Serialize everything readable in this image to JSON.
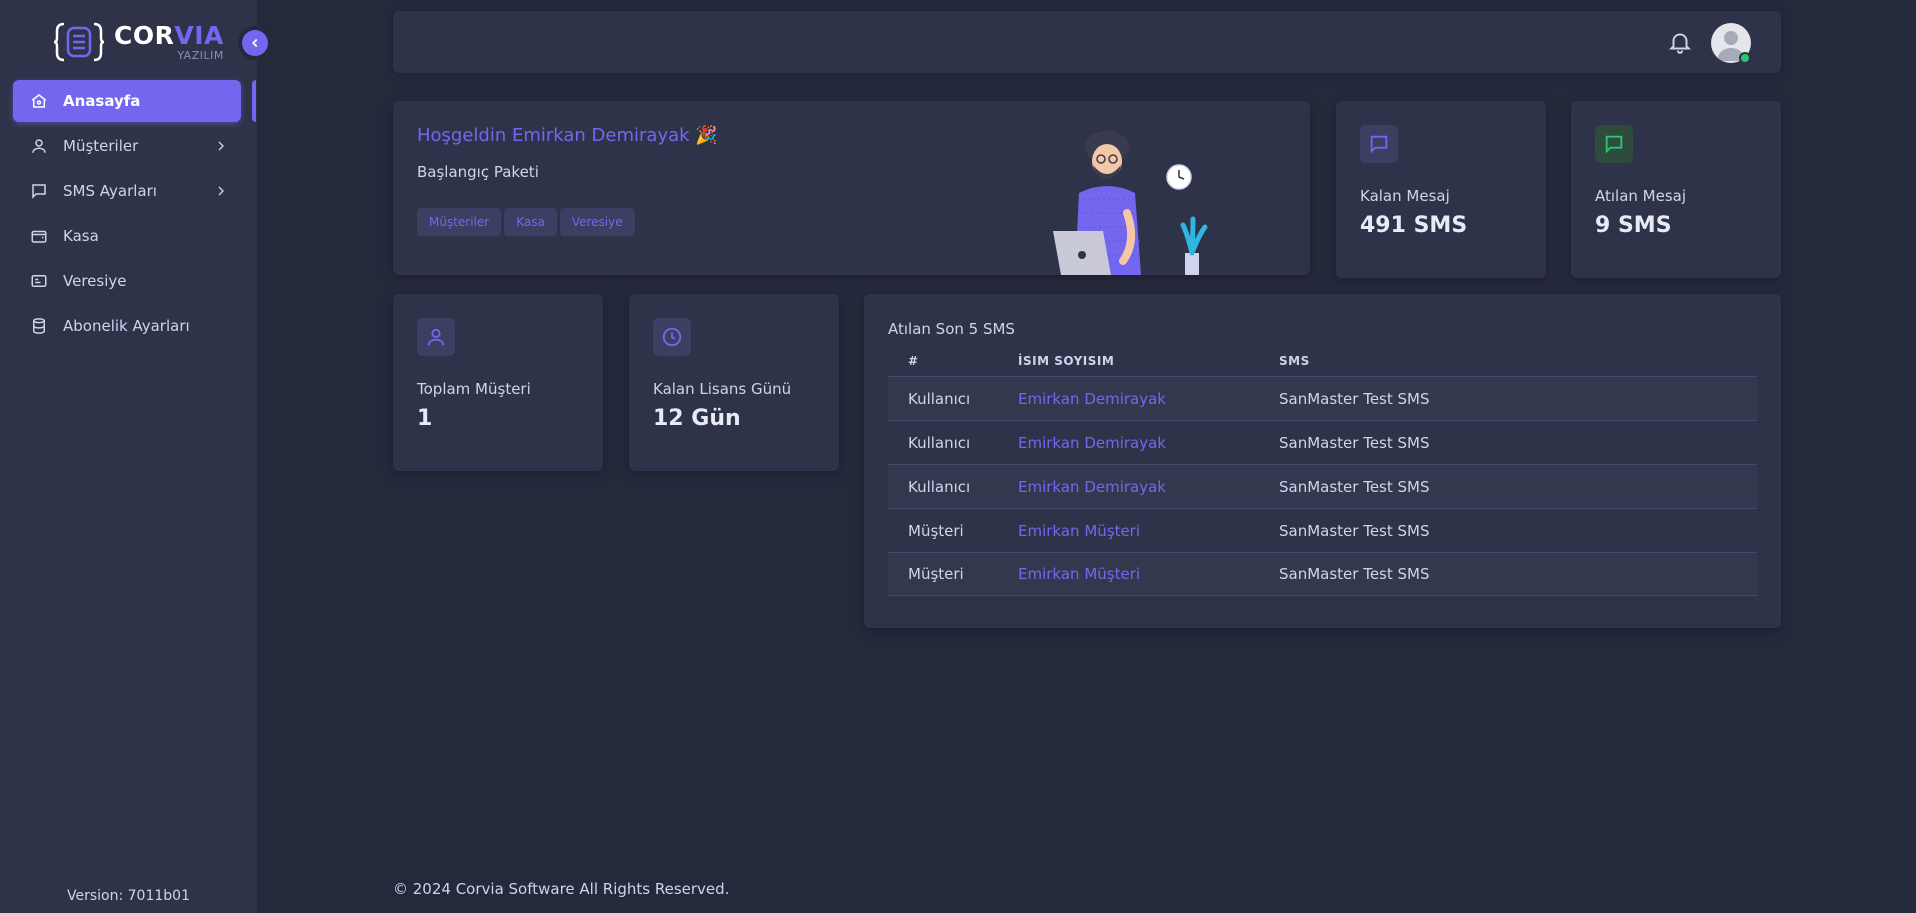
{
  "brand": {
    "name_part1": "COR",
    "name_part2": "VIA",
    "subtitle": "YAZILIM"
  },
  "sidebar": {
    "items": [
      {
        "label": "Anasayfa",
        "icon": "home-icon",
        "active": true,
        "has_submenu": false
      },
      {
        "label": "Müşteriler",
        "icon": "user-icon",
        "active": false,
        "has_submenu": true
      },
      {
        "label": "SMS Ayarları",
        "icon": "message-icon",
        "active": false,
        "has_submenu": true
      },
      {
        "label": "Kasa",
        "icon": "wallet-icon",
        "active": false,
        "has_submenu": false
      },
      {
        "label": "Veresiye",
        "icon": "id-card-icon",
        "active": false,
        "has_submenu": false
      },
      {
        "label": "Abonelik Ayarları",
        "icon": "database-icon",
        "active": false,
        "has_submenu": false
      }
    ],
    "version": "Version: 7011b01"
  },
  "welcome": {
    "title": "Hoşgeldin Emirkan Demirayak 🎉",
    "package": "Başlangıç Paketi",
    "chips": [
      "Müşteriler",
      "Kasa",
      "Veresiye"
    ]
  },
  "stats": {
    "kalan_mesaj": {
      "label": "Kalan Mesaj",
      "value": "491 SMS"
    },
    "atilan_mesaj": {
      "label": "Atılan Mesaj",
      "value": "9 SMS"
    },
    "toplam_musteri": {
      "label": "Toplam Müşteri",
      "value": "1"
    },
    "kalan_lisans": {
      "label": "Kalan Lisans Günü",
      "value": "12 Gün"
    }
  },
  "sms_table": {
    "title": "Atılan Son 5 SMS",
    "headers": [
      "#",
      "İSIM SOYISIM",
      "SMS"
    ],
    "rows": [
      {
        "type": "Kullanıcı",
        "name": "Emirkan Demirayak",
        "sms": "SanMaster Test SMS"
      },
      {
        "type": "Kullanıcı",
        "name": "Emirkan Demirayak",
        "sms": "SanMaster Test SMS"
      },
      {
        "type": "Kullanıcı",
        "name": "Emirkan Demirayak",
        "sms": "SanMaster Test SMS"
      },
      {
        "type": "Müşteri",
        "name": "Emirkan Müşteri",
        "sms": "SanMaster Test SMS"
      },
      {
        "type": "Müşteri",
        "name": "Emirkan Müşteri",
        "sms": "SanMaster Test SMS"
      }
    ]
  },
  "footer": {
    "text": "© 2024 Corvia Software All Rights Reserved."
  },
  "colors": {
    "accent": "#7367f0",
    "success": "#28c76f",
    "background": "#25293c",
    "card": "#2f3349"
  }
}
